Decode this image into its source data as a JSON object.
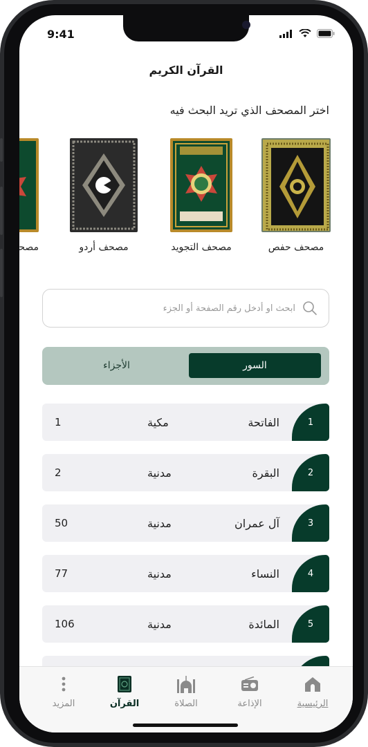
{
  "status": {
    "time": "9:41"
  },
  "app": {
    "title": "القرآن الكريم"
  },
  "mushaf_section": {
    "label": "اختر المصحف الذي تريد البحث فيه",
    "items": [
      {
        "label": "مصحف حفص"
      },
      {
        "label": "مصحف التجويد"
      },
      {
        "label": "مصحف أردو"
      },
      {
        "label": "مصحف الإ..."
      }
    ]
  },
  "search": {
    "placeholder": "ابحث او أدخل رقم الصفحة أو الجزء"
  },
  "segment": {
    "active": "السور",
    "inactive": "الأجزاء"
  },
  "surahs": [
    {
      "number": "1",
      "name": "الفاتحة",
      "type": "مكية",
      "ayat": "1"
    },
    {
      "number": "2",
      "name": "البقرة",
      "type": "مدنية",
      "ayat": "2"
    },
    {
      "number": "3",
      "name": "آل عمران",
      "type": "مدنية",
      "ayat": "50"
    },
    {
      "number": "4",
      "name": "النساء",
      "type": "مدنية",
      "ayat": "77"
    },
    {
      "number": "5",
      "name": "المائدة",
      "type": "مدنية",
      "ayat": "106"
    }
  ],
  "tabbar": {
    "home": "الرئيسية",
    "radio": "الإذاعة",
    "prayer": "الصلاة",
    "quran": "القرآن",
    "more": "المزيد"
  },
  "colors": {
    "primary": "#073b2b",
    "segment_bg": "#b4c7bf",
    "row_bg": "#f0f0f3"
  }
}
